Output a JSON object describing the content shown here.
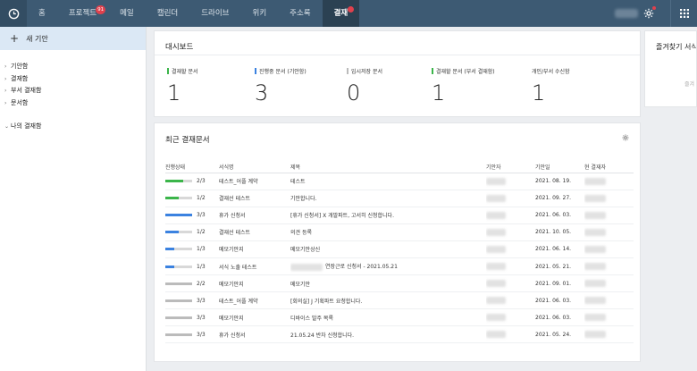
{
  "nav": {
    "items": [
      {
        "label": "홈",
        "name": "nav-home",
        "badge": ""
      },
      {
        "label": "프로젝트",
        "name": "nav-project",
        "badge": "91"
      },
      {
        "label": "메일",
        "name": "nav-mail",
        "badge": ""
      },
      {
        "label": "캘린더",
        "name": "nav-calendar",
        "badge": ""
      },
      {
        "label": "드라이브",
        "name": "nav-drive",
        "badge": ""
      },
      {
        "label": "위키",
        "name": "nav-wiki",
        "badge": ""
      },
      {
        "label": "주소록",
        "name": "nav-contacts",
        "badge": ""
      },
      {
        "label": "결재",
        "name": "nav-approval",
        "badge": "dot",
        "active": true
      }
    ]
  },
  "sidebar": {
    "new_label": "새 기안",
    "items": [
      {
        "label": "기안함"
      },
      {
        "label": "결재함"
      },
      {
        "label": "부서 결재함"
      },
      {
        "label": "문서함"
      }
    ],
    "group_label": "나의 결재함"
  },
  "dashboard": {
    "title": "대시보드",
    "stats": [
      {
        "label": "결재할 문서",
        "value": "1",
        "color": "#3bb54a"
      },
      {
        "label": "진행중 문서 (기안함)",
        "value": "3",
        "color": "#3b82e0"
      },
      {
        "label": "임시저장 문서",
        "value": "0",
        "color": "#bbbbbb"
      },
      {
        "label": "결재할 문서 (부서 결재함)",
        "value": "1",
        "color": "#3bb54a"
      },
      {
        "label": "개인/부서 수신함",
        "value": "1",
        "color": ""
      }
    ]
  },
  "search_card": {
    "title": "즐겨찾기 서식",
    "hint": "즐겨"
  },
  "recent": {
    "title": "최근 결재문서",
    "columns": [
      "진행상태",
      "서식명",
      "제목",
      "기안자",
      "기안일",
      "현 결재자"
    ],
    "rows": [
      {
        "progress": "2/3",
        "ratio": 0.67,
        "color": "#3bb54a",
        "form": "테스트_어플 계약",
        "title": "테스트",
        "date": "2021. 08. 19."
      },
      {
        "progress": "1/2",
        "ratio": 0.5,
        "color": "#3bb54a",
        "form": "결재선 테스트",
        "title": "기안합니다.",
        "date": "2021. 09. 27."
      },
      {
        "progress": "3/3",
        "ratio": 1.0,
        "color": "#3b82e0",
        "form": "휴가 신청서",
        "title": "[휴가 신청서] X 개발파트, 고서히 신청합니다.",
        "date": "2021. 06. 03."
      },
      {
        "progress": "1/2",
        "ratio": 0.5,
        "color": "#3b82e0",
        "form": "결재선 테스트",
        "title": "의견 등록",
        "date": "2021. 10. 05."
      },
      {
        "progress": "1/3",
        "ratio": 0.33,
        "color": "#3b82e0",
        "form": "메모기안지",
        "title": "메모기안상신",
        "date": "2021. 06. 14."
      },
      {
        "progress": "1/3",
        "ratio": 0.33,
        "color": "#3b82e0",
        "form": "서식 노출 테스트",
        "title": "연장근로 신청서 - 2021.05.21",
        "date": "2021. 05. 21.",
        "title_blur": true
      },
      {
        "progress": "2/2",
        "ratio": 1.0,
        "color": "#bbbbbb",
        "form": "메모기안지",
        "title": "메모기안",
        "date": "2021. 09. 01."
      },
      {
        "progress": "3/3",
        "ratio": 1.0,
        "color": "#bbbbbb",
        "form": "테스트_어플 계약",
        "title": "[회의실] J 기획파트 요청합니다.",
        "date": "2021. 06. 03."
      },
      {
        "progress": "3/3",
        "ratio": 1.0,
        "color": "#bbbbbb",
        "form": "메모기안지",
        "title": "디바이스 발주 목록",
        "date": "2021. 06. 03."
      },
      {
        "progress": "3/3",
        "ratio": 1.0,
        "color": "#bbbbbb",
        "form": "휴가 신청서",
        "title": "21.05.24 반차 신청합니다.",
        "date": "2021. 05. 24."
      }
    ]
  }
}
